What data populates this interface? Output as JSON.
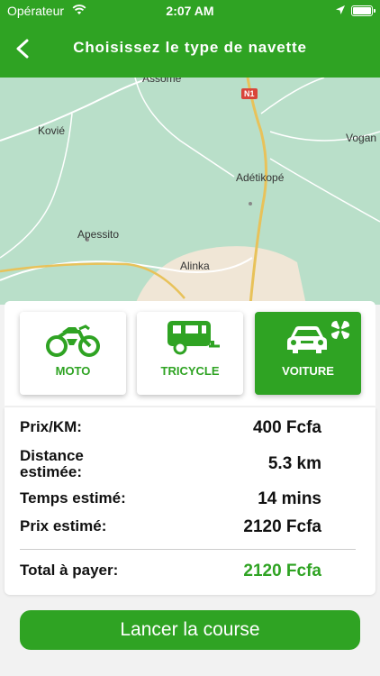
{
  "status_bar": {
    "carrier": "Opérateur",
    "time": "2:07 AM",
    "battery_level": 1.0
  },
  "header": {
    "title": "Choisissez le type de navette",
    "back_icon": "chevron-left-icon"
  },
  "map": {
    "road_badge": "N1",
    "labels": {
      "assome": "Assome",
      "kovie": "Kovié",
      "vogan": "Vogan",
      "adetikope": "Adétikopé",
      "apessito": "Apessito",
      "alinka": "Alinka"
    },
    "colors": {
      "land": "#b9dfc9",
      "urban": "#f0e6d6",
      "road": "#e8c25a"
    }
  },
  "vehicle_types": [
    {
      "label": "MOTO",
      "icon": "motorcycle-icon",
      "selected": false
    },
    {
      "label": "TRICYCLE",
      "icon": "tricycle-icon",
      "selected": false
    },
    {
      "label": "VOITURE",
      "icon": "car-icon",
      "selected": true
    }
  ],
  "pricing": {
    "price_per_km_label": "Prix/KM:",
    "price_per_km_value": "400 Fcfa",
    "distance_label_line1": "Distance",
    "distance_label_line2": "estimée:",
    "distance_value": "5.3 km",
    "time_label": "Temps estimé:",
    "time_value": "14 mins",
    "price_est_label": "Prix estimé:",
    "price_est_value": "2120 Fcfa",
    "total_label": "Total à payer:",
    "total_value": "2120 Fcfa"
  },
  "cta": {
    "label": "Lancer la course"
  },
  "colors": {
    "accent": "#2fa323",
    "badge_red": "#d9453a"
  }
}
